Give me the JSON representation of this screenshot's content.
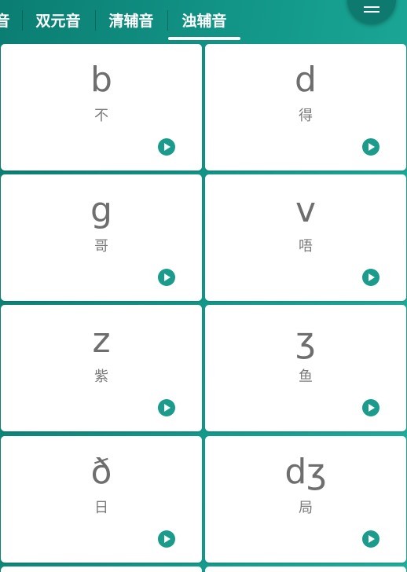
{
  "tabs": [
    {
      "label": "音"
    },
    {
      "label": "双元音"
    },
    {
      "label": "清辅音"
    },
    {
      "label": "浊辅音",
      "selected": true
    }
  ],
  "menu": {
    "icon": "menu-icon"
  },
  "phonemes": [
    {
      "symbol": "b",
      "example": "不"
    },
    {
      "symbol": "d",
      "example": "得"
    },
    {
      "symbol": "g",
      "example": "哥"
    },
    {
      "symbol": "v",
      "example": "唔"
    },
    {
      "symbol": "z",
      "example": "紫"
    },
    {
      "symbol": "ʒ",
      "example": "鱼"
    },
    {
      "symbol": "ð",
      "example": "日"
    },
    {
      "symbol": "dʒ",
      "example": "局"
    }
  ],
  "colors": {
    "header_bg": "#0b7d72",
    "accent": "#1a9b8b",
    "card_bg": "#ffffff",
    "symbol_text": "#6e6e6e"
  }
}
